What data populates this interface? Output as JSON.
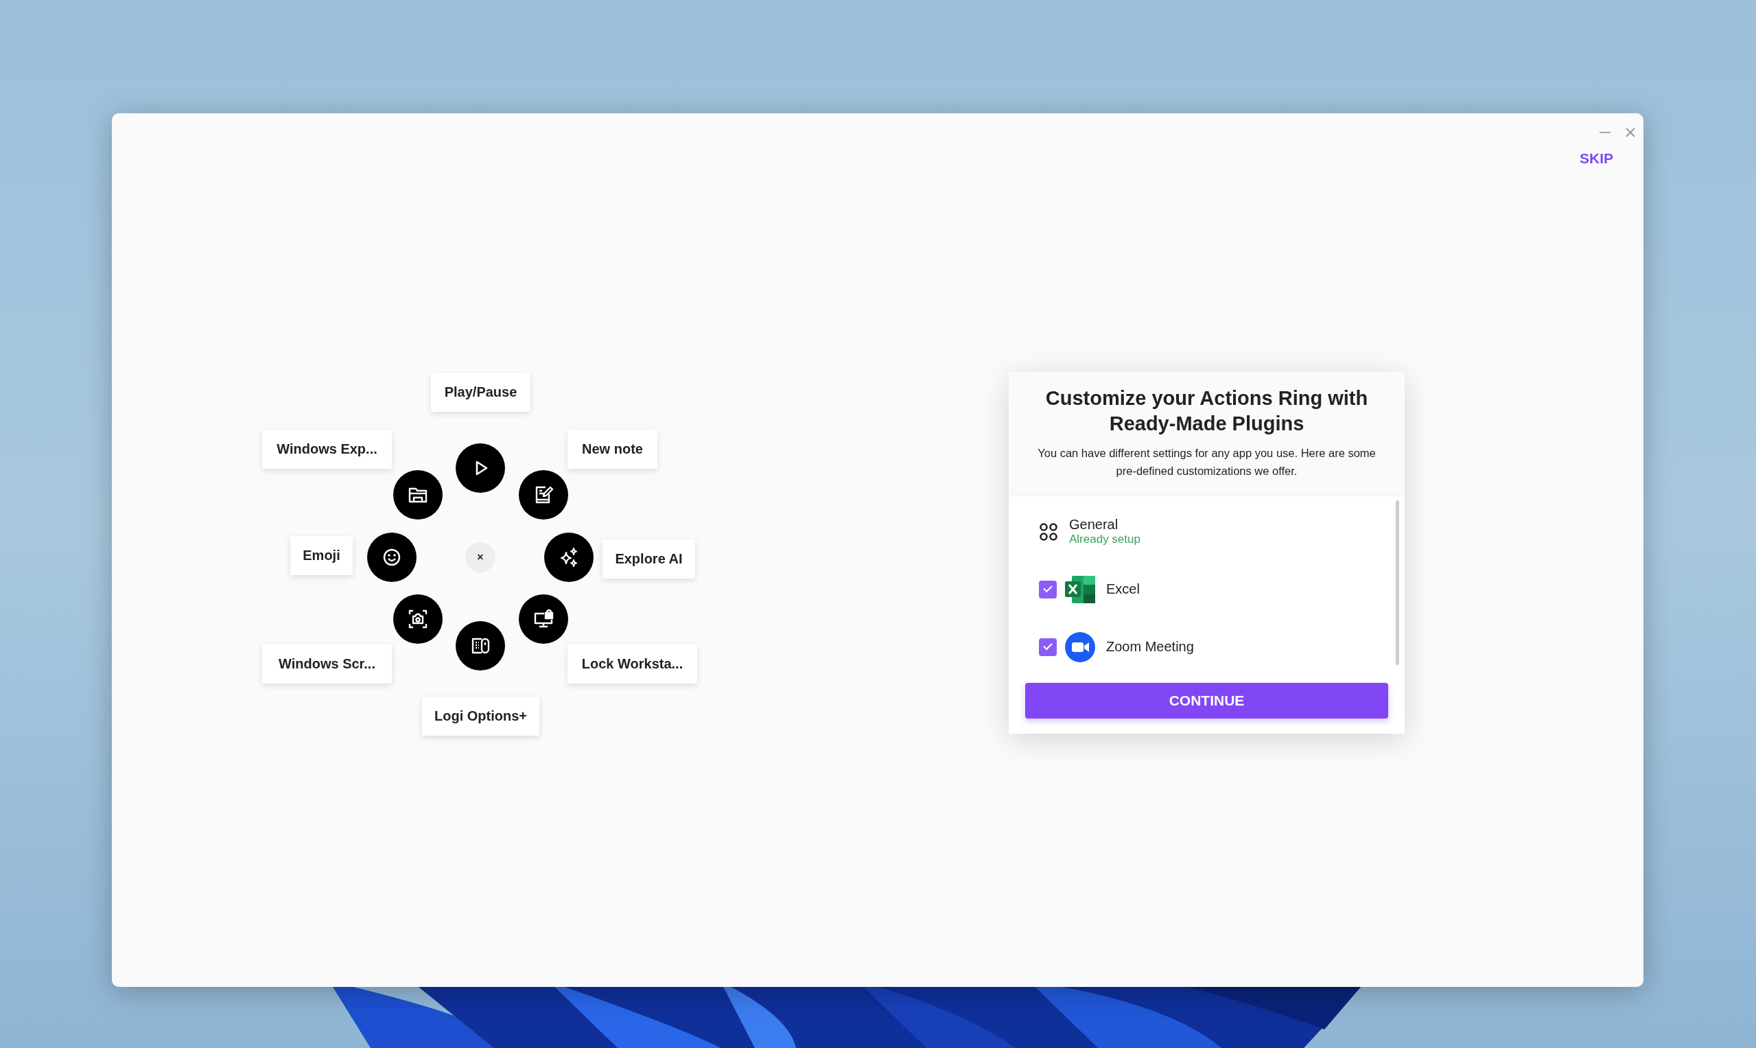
{
  "window": {
    "skip": "SKIP"
  },
  "ring": {
    "center": "×",
    "actions": [
      {
        "label": "Play/Pause",
        "kind": "play"
      },
      {
        "label": "Windows Exp...",
        "kind": "folder"
      },
      {
        "label": "New note",
        "kind": "note"
      },
      {
        "label": "Emoji",
        "kind": "emoji"
      },
      {
        "label": "Explore AI",
        "kind": "sparkle"
      },
      {
        "label": "Windows Scr...",
        "kind": "screenshot"
      },
      {
        "label": "Lock Worksta...",
        "kind": "lock"
      },
      {
        "label": "Logi Options+",
        "kind": "device"
      }
    ]
  },
  "panel": {
    "title": "Customize your Actions Ring with Ready-Made Plugins",
    "description": "You can have different settings for any app you use. Here are some pre-defined customizations we offer.",
    "plugins": [
      {
        "kind": "setup",
        "name": "General",
        "status": "Already setup"
      },
      {
        "kind": "spreadsheet",
        "name": "Excel",
        "checked": true
      },
      {
        "kind": "video",
        "name": "Zoom Meeting",
        "checked": true
      }
    ],
    "button": "CONTINUE"
  }
}
